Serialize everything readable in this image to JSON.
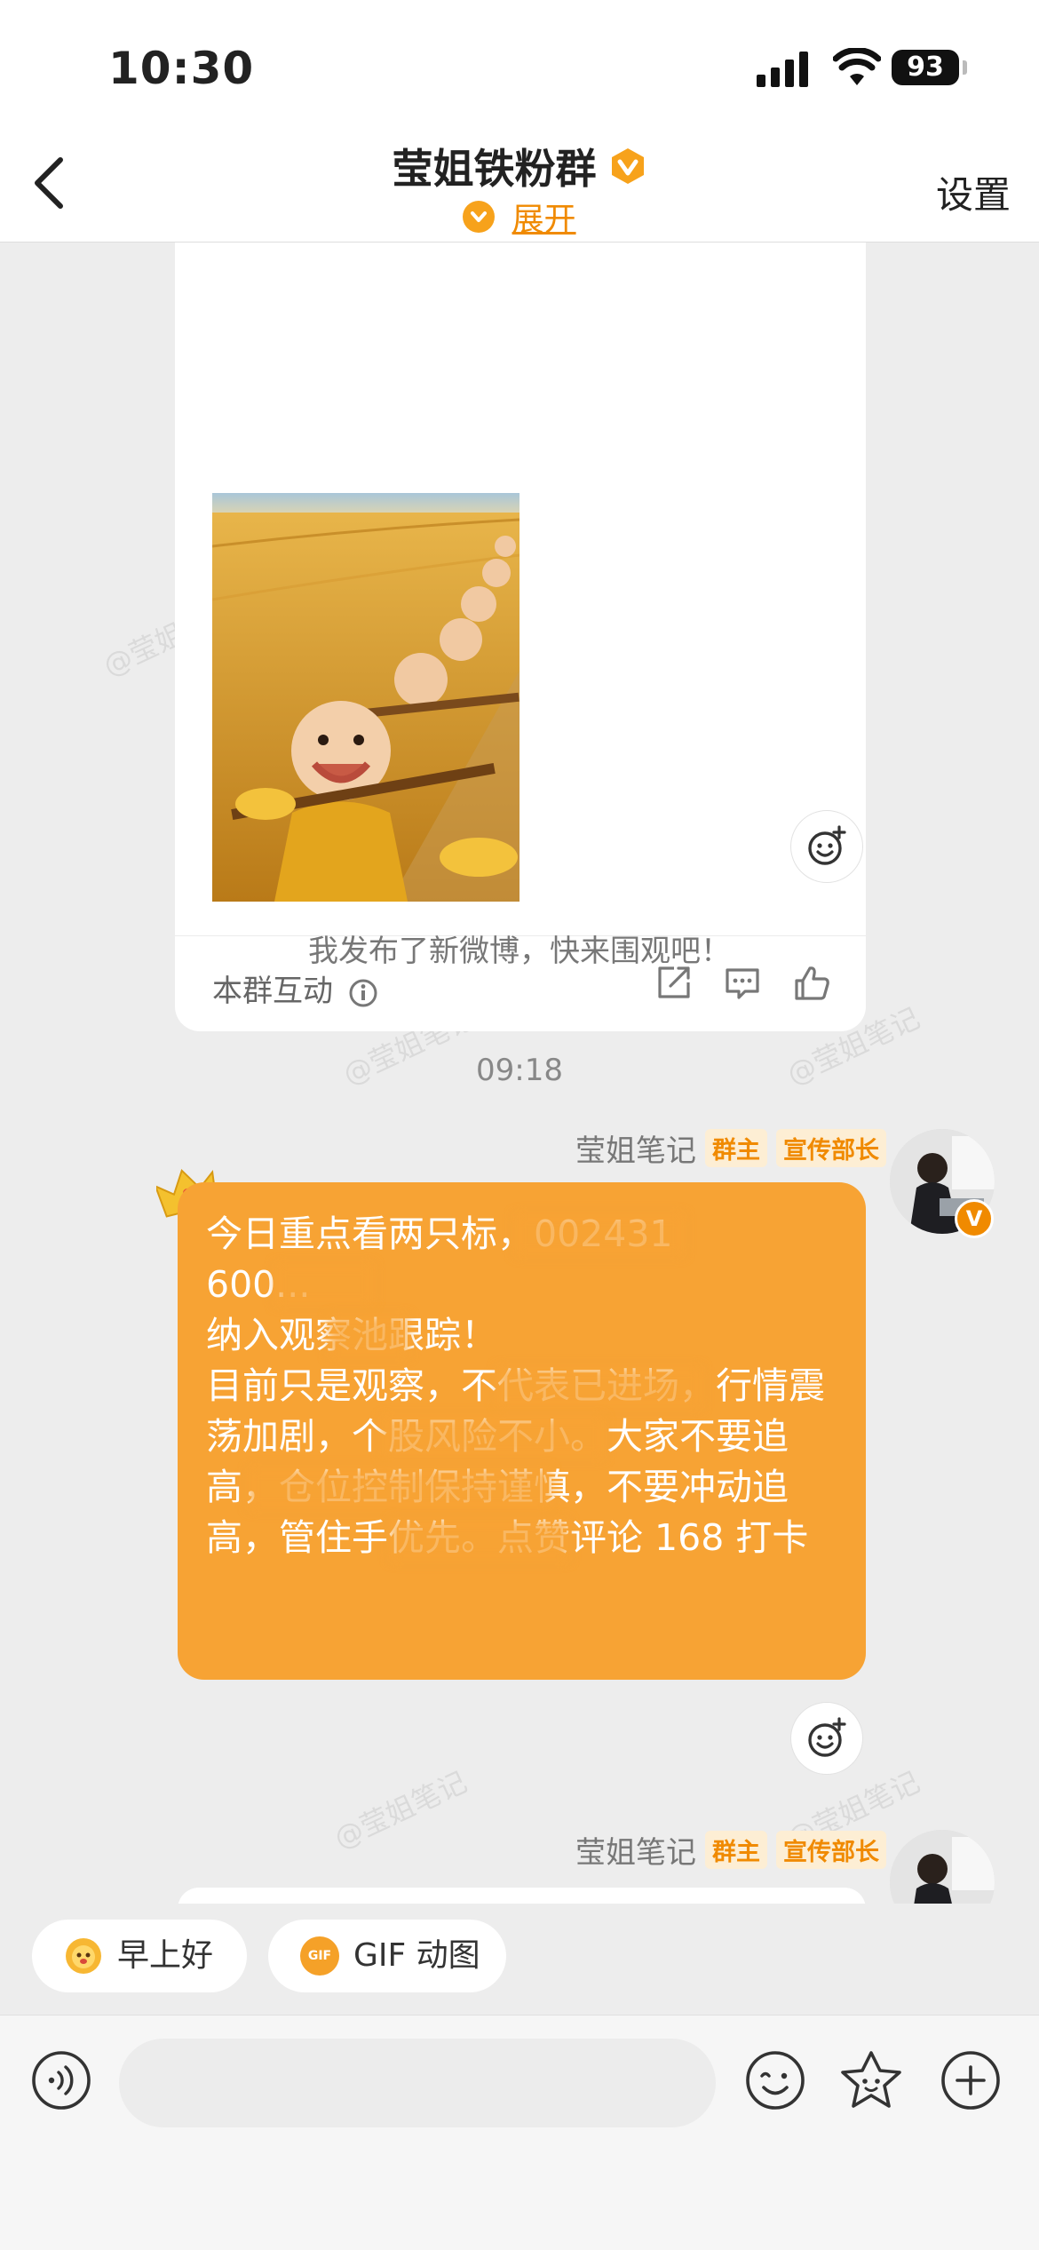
{
  "status_bar": {
    "time": "10:30",
    "battery": "93"
  },
  "nav": {
    "title": "莹姐铁粉群",
    "expand_label": "展开",
    "settings_label": "设置"
  },
  "card": {
    "interact_label": "本群互动"
  },
  "system_message": "我发布了新微博，快来围观吧！",
  "timestamp": "09:18",
  "messages": [
    {
      "sender": "莹姐笔记",
      "tags": [
        "群主",
        "宣传部长"
      ],
      "text": "今日重点看两只标，002431\n600...\n纳入观察池跟踪！\n目前只是观察，不代表已进场，行情震荡加剧，个股风险不小。大家不要追高，仓位控制保持谨慎，不要冲动追高，管住手优先。点赞评论 168 打卡"
    },
    {
      "sender": "莹姐笔记",
      "tags": [
        "群主",
        "宣传部长"
      ]
    }
  ],
  "quick_replies": [
    "早上好",
    "GIF 动图"
  ],
  "quick_reply_gif_badge": "GIF",
  "input": {
    "placeholder": ""
  },
  "watermark_text": "@莹姐笔记",
  "colors": {
    "accent": "#f08a00",
    "bubble": "#f7a334",
    "background": "#ededed"
  },
  "icons": [
    "back-arrow-icon",
    "verified-badge-icon",
    "info-icon",
    "share-icon",
    "comment-icon",
    "like-icon",
    "add-reaction-icon",
    "crown-icon",
    "voice-icon",
    "emoji-icon",
    "sticker-icon",
    "plus-icon"
  ]
}
